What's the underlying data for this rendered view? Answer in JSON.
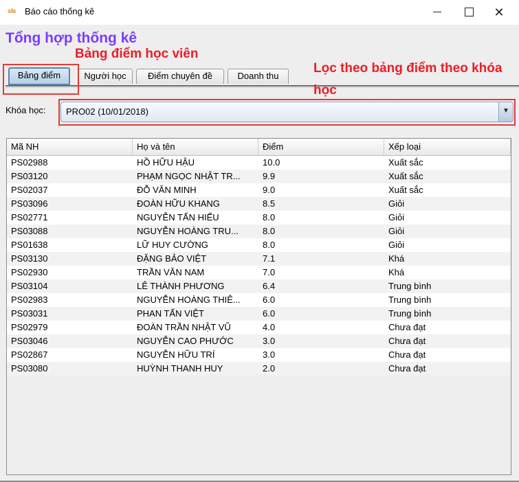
{
  "window": {
    "app_icon": "sfa",
    "title": "Báo cáo thống kê",
    "minimize_icon": "minimize-icon",
    "maximize_icon": "maximize-icon",
    "close_icon": "close-icon",
    "close_glyph": "✕"
  },
  "heading": "Tổng hợp thống kê",
  "annotations": {
    "tab_note": "Bảng điểm học viên",
    "filter_note": "Lọc theo bảng điểm theo khóa học",
    "color": "#ee1c25"
  },
  "tabs": [
    {
      "label": "Bảng điểm",
      "active": true
    },
    {
      "label": "Người học",
      "active": false
    },
    {
      "label": "Điểm chuyên đề",
      "active": false
    },
    {
      "label": "Doanh thu",
      "active": false
    }
  ],
  "filter": {
    "label": "Khóa học:",
    "selected": "PRO02 (10/01/2018)",
    "arrow_glyph": "▼"
  },
  "table": {
    "columns": [
      "Mã NH",
      "Họ và tên",
      "Điểm",
      "Xếp loại"
    ],
    "rows": [
      [
        "PS02988",
        "HỒ HỮU HẬU",
        "10.0",
        "Xuất sắc"
      ],
      [
        "PS03120",
        "PHẠM NGỌC NHẬT TR...",
        "9.9",
        "Xuất sắc"
      ],
      [
        "PS02037",
        "ĐỖ VĂN MINH",
        "9.0",
        "Xuất sắc"
      ],
      [
        "PS03096",
        "ĐOÀN HỮU KHANG",
        "8.5",
        "Giỏi"
      ],
      [
        "PS02771",
        "NGUYỄN TẤN HIẾU",
        "8.0",
        "Giỏi"
      ],
      [
        "PS03088",
        "NGUYỄN HOÀNG TRU...",
        "8.0",
        "Giỏi"
      ],
      [
        "PS01638",
        "LỮ HUY CƯỜNG",
        "8.0",
        "Giỏi"
      ],
      [
        "PS03130",
        "ĐẶNG BẢO VIỆT",
        "7.1",
        "Khá"
      ],
      [
        "PS02930",
        "TRẦN VĂN NAM",
        "7.0",
        "Khá"
      ],
      [
        "PS03104",
        "LÊ THÀNH PHƯƠNG",
        "6.4",
        "Trung bình"
      ],
      [
        "PS02983",
        "NGUYỄN HOÀNG THIÊ...",
        "6.0",
        "Trung bình"
      ],
      [
        "PS03031",
        "PHAN TẤN VIỆT",
        "6.0",
        "Trung bình"
      ],
      [
        "PS02979",
        "ĐOÀN TRẦN NHẬT VŨ",
        "4.0",
        "Chưa đạt"
      ],
      [
        "PS03046",
        "NGUYỄN CAO PHƯỚC",
        "3.0",
        "Chưa đạt"
      ],
      [
        "PS02867",
        "NGUYỄN HỮU TRÍ",
        "3.0",
        "Chưa đạt"
      ],
      [
        "PS03080",
        "HUỲNH THANH HUY",
        "2.0",
        "Chưa đạt"
      ]
    ]
  }
}
